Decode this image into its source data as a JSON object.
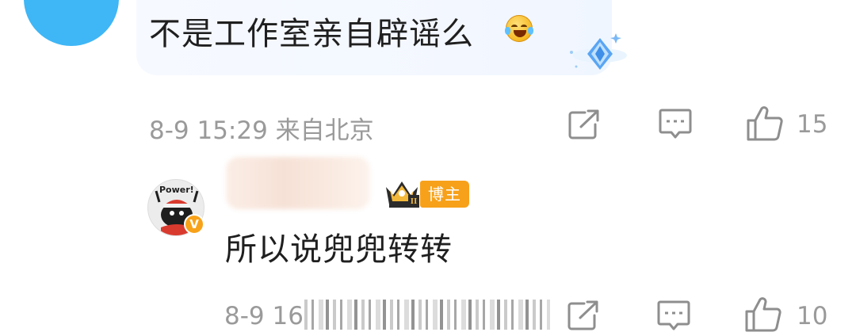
{
  "top_comment": {
    "text": "不是工作室亲自辟谣么",
    "emoji_icon": "laughing-crying-emoji",
    "badge_icon": "diamond-badge-icon",
    "meta": "8-9 15:29 来自北京",
    "like_count": "15"
  },
  "reply": {
    "avatar_label": "Power!",
    "verified_mark": "V",
    "crown_level": "II",
    "role_badge": "博主",
    "text": "所以说兜兜转转",
    "meta": "8-9 16",
    "like_count": "10"
  },
  "colors": {
    "accent_orange": "#f7a11a",
    "meta_gray": "#9a9a9a",
    "avatar_blue": "#3fb6f6"
  }
}
